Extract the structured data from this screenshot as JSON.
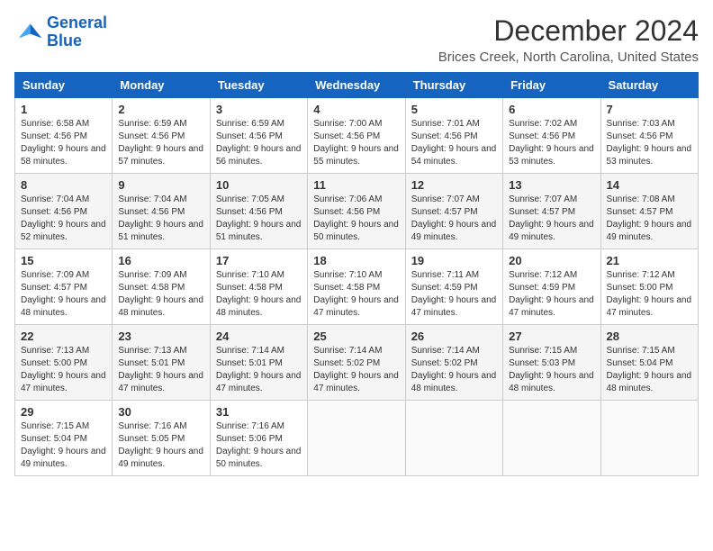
{
  "logo": {
    "line1": "General",
    "line2": "Blue"
  },
  "title": "December 2024",
  "location": "Brices Creek, North Carolina, United States",
  "days_of_week": [
    "Sunday",
    "Monday",
    "Tuesday",
    "Wednesday",
    "Thursday",
    "Friday",
    "Saturday"
  ],
  "weeks": [
    [
      {
        "day": "1",
        "sunrise": "6:58 AM",
        "sunset": "4:56 PM",
        "daylight": "9 hours and 58 minutes."
      },
      {
        "day": "2",
        "sunrise": "6:59 AM",
        "sunset": "4:56 PM",
        "daylight": "9 hours and 57 minutes."
      },
      {
        "day": "3",
        "sunrise": "6:59 AM",
        "sunset": "4:56 PM",
        "daylight": "9 hours and 56 minutes."
      },
      {
        "day": "4",
        "sunrise": "7:00 AM",
        "sunset": "4:56 PM",
        "daylight": "9 hours and 55 minutes."
      },
      {
        "day": "5",
        "sunrise": "7:01 AM",
        "sunset": "4:56 PM",
        "daylight": "9 hours and 54 minutes."
      },
      {
        "day": "6",
        "sunrise": "7:02 AM",
        "sunset": "4:56 PM",
        "daylight": "9 hours and 53 minutes."
      },
      {
        "day": "7",
        "sunrise": "7:03 AM",
        "sunset": "4:56 PM",
        "daylight": "9 hours and 53 minutes."
      }
    ],
    [
      {
        "day": "8",
        "sunrise": "7:04 AM",
        "sunset": "4:56 PM",
        "daylight": "9 hours and 52 minutes."
      },
      {
        "day": "9",
        "sunrise": "7:04 AM",
        "sunset": "4:56 PM",
        "daylight": "9 hours and 51 minutes."
      },
      {
        "day": "10",
        "sunrise": "7:05 AM",
        "sunset": "4:56 PM",
        "daylight": "9 hours and 51 minutes."
      },
      {
        "day": "11",
        "sunrise": "7:06 AM",
        "sunset": "4:56 PM",
        "daylight": "9 hours and 50 minutes."
      },
      {
        "day": "12",
        "sunrise": "7:07 AM",
        "sunset": "4:57 PM",
        "daylight": "9 hours and 49 minutes."
      },
      {
        "day": "13",
        "sunrise": "7:07 AM",
        "sunset": "4:57 PM",
        "daylight": "9 hours and 49 minutes."
      },
      {
        "day": "14",
        "sunrise": "7:08 AM",
        "sunset": "4:57 PM",
        "daylight": "9 hours and 49 minutes."
      }
    ],
    [
      {
        "day": "15",
        "sunrise": "7:09 AM",
        "sunset": "4:57 PM",
        "daylight": "9 hours and 48 minutes."
      },
      {
        "day": "16",
        "sunrise": "7:09 AM",
        "sunset": "4:58 PM",
        "daylight": "9 hours and 48 minutes."
      },
      {
        "day": "17",
        "sunrise": "7:10 AM",
        "sunset": "4:58 PM",
        "daylight": "9 hours and 48 minutes."
      },
      {
        "day": "18",
        "sunrise": "7:10 AM",
        "sunset": "4:58 PM",
        "daylight": "9 hours and 47 minutes."
      },
      {
        "day": "19",
        "sunrise": "7:11 AM",
        "sunset": "4:59 PM",
        "daylight": "9 hours and 47 minutes."
      },
      {
        "day": "20",
        "sunrise": "7:12 AM",
        "sunset": "4:59 PM",
        "daylight": "9 hours and 47 minutes."
      },
      {
        "day": "21",
        "sunrise": "7:12 AM",
        "sunset": "5:00 PM",
        "daylight": "9 hours and 47 minutes."
      }
    ],
    [
      {
        "day": "22",
        "sunrise": "7:13 AM",
        "sunset": "5:00 PM",
        "daylight": "9 hours and 47 minutes."
      },
      {
        "day": "23",
        "sunrise": "7:13 AM",
        "sunset": "5:01 PM",
        "daylight": "9 hours and 47 minutes."
      },
      {
        "day": "24",
        "sunrise": "7:14 AM",
        "sunset": "5:01 PM",
        "daylight": "9 hours and 47 minutes."
      },
      {
        "day": "25",
        "sunrise": "7:14 AM",
        "sunset": "5:02 PM",
        "daylight": "9 hours and 47 minutes."
      },
      {
        "day": "26",
        "sunrise": "7:14 AM",
        "sunset": "5:02 PM",
        "daylight": "9 hours and 48 minutes."
      },
      {
        "day": "27",
        "sunrise": "7:15 AM",
        "sunset": "5:03 PM",
        "daylight": "9 hours and 48 minutes."
      },
      {
        "day": "28",
        "sunrise": "7:15 AM",
        "sunset": "5:04 PM",
        "daylight": "9 hours and 48 minutes."
      }
    ],
    [
      {
        "day": "29",
        "sunrise": "7:15 AM",
        "sunset": "5:04 PM",
        "daylight": "9 hours and 49 minutes."
      },
      {
        "day": "30",
        "sunrise": "7:16 AM",
        "sunset": "5:05 PM",
        "daylight": "9 hours and 49 minutes."
      },
      {
        "day": "31",
        "sunrise": "7:16 AM",
        "sunset": "5:06 PM",
        "daylight": "9 hours and 50 minutes."
      },
      null,
      null,
      null,
      null
    ]
  ]
}
